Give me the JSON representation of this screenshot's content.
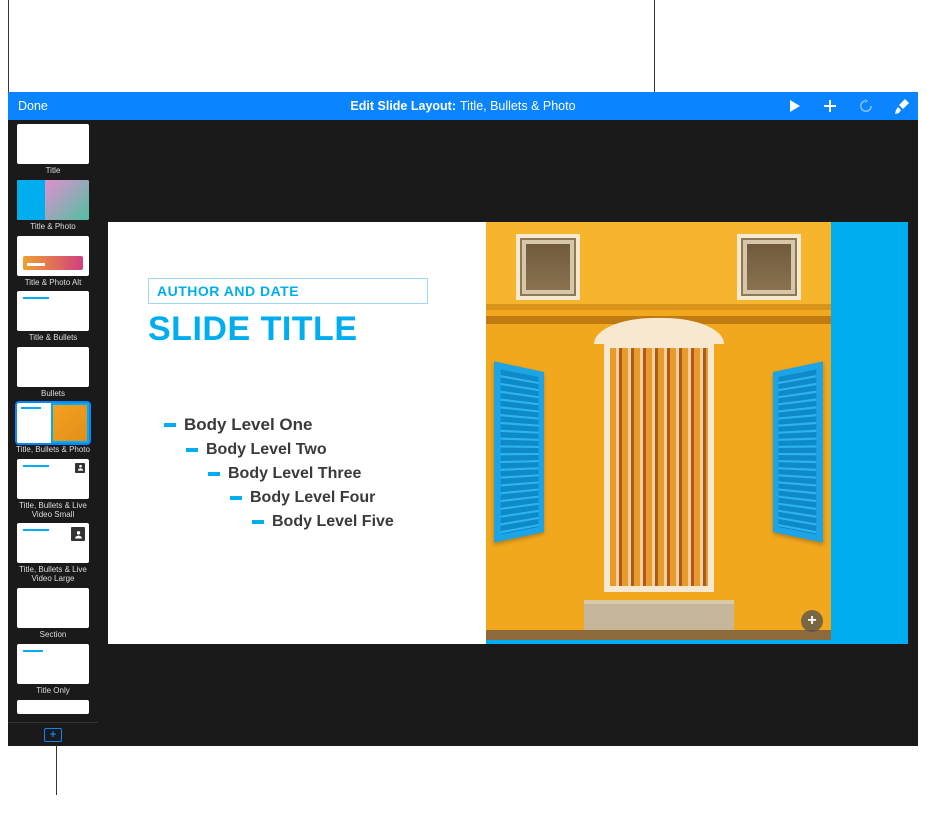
{
  "toolbar": {
    "done_label": "Done",
    "center_label": "Edit Slide Layout:",
    "center_value": "Title, Bullets & Photo",
    "icons": {
      "play": "play-icon",
      "add": "plus-icon",
      "history": "history-icon",
      "format": "paintbrush-icon"
    }
  },
  "sidebar": {
    "items": [
      {
        "label": "Title",
        "preview": "cyan"
      },
      {
        "label": "Title & Photo",
        "preview": "photo"
      },
      {
        "label": "Title & Photo Alt",
        "preview": "photo-alt"
      },
      {
        "label": "Title & Bullets",
        "preview": "white-line"
      },
      {
        "label": "Bullets",
        "preview": "white"
      },
      {
        "label": "Title, Bullets & Photo",
        "preview": "bullets-photo",
        "selected": true
      },
      {
        "label": "Title, Bullets & Live Video Small",
        "preview": "video-sm"
      },
      {
        "label": "Title, Bullets & Live Video Large",
        "preview": "video-lg"
      },
      {
        "label": "Section",
        "preview": "section"
      },
      {
        "label": "Title Only",
        "preview": "title-only"
      },
      {
        "label": "",
        "preview": "yellow"
      }
    ],
    "add_label": "+"
  },
  "slide": {
    "author_date": "AUTHOR AND DATE",
    "title": "SLIDE TITLE",
    "bullets": [
      "Body Level One",
      "Body Level Two",
      "Body Level Three",
      "Body Level Four",
      "Body Level Five"
    ],
    "add_media_label": "+"
  }
}
